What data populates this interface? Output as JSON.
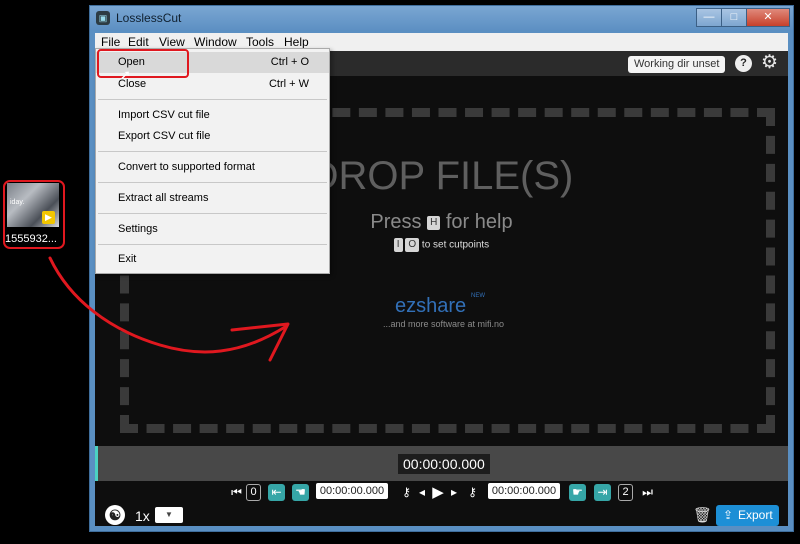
{
  "desktop": {
    "file_label": "1555932...",
    "thumb_text": "iday.",
    "badge_icon": "play-badge-icon"
  },
  "window": {
    "title": "LosslessCut",
    "controls": {
      "minimize": "—",
      "maximize": "□",
      "close": "✕"
    }
  },
  "menubar": [
    "File",
    "Edit",
    "View",
    "Window",
    "Tools",
    "Help"
  ],
  "file_menu": {
    "items": [
      {
        "label": "Open",
        "shortcut": "Ctrl + O"
      },
      {
        "label": "Close",
        "shortcut": "Ctrl + W"
      },
      {
        "label": "Import CSV cut file",
        "shortcut": ""
      },
      {
        "label": "Export CSV cut file",
        "shortcut": ""
      },
      {
        "label": "Convert to supported format",
        "shortcut": ""
      },
      {
        "label": "Extract all streams",
        "shortcut": ""
      },
      {
        "label": "Settings",
        "shortcut": ""
      },
      {
        "label": "Exit",
        "shortcut": ""
      }
    ]
  },
  "topbar": {
    "working_dir_label": "Working dir unset",
    "help_label": "?"
  },
  "drop_zone": {
    "title": "DROP FILE(S)",
    "press_prefix": "Press",
    "press_key": "H",
    "press_suffix": "for help",
    "cut_key_in": "I",
    "cut_key_out": "O",
    "cut_text": "to set cutpoints",
    "brand": "ezshare",
    "brand_badge": "NEW",
    "brand_sub": "...and more software at mifi.no"
  },
  "timeline": {
    "current_time": "00:00:00.000"
  },
  "controls": {
    "cut_start_num": "0",
    "cut_start_time": "00:00:00.000",
    "cut_end_time": "00:00:00.000",
    "cut_end_num": "2",
    "speed": "1x",
    "export_label": "Export"
  },
  "colors": {
    "accent_teal": "#36a6a7",
    "export_blue": "#1d8fd6",
    "annotation_red": "#e0181f"
  }
}
